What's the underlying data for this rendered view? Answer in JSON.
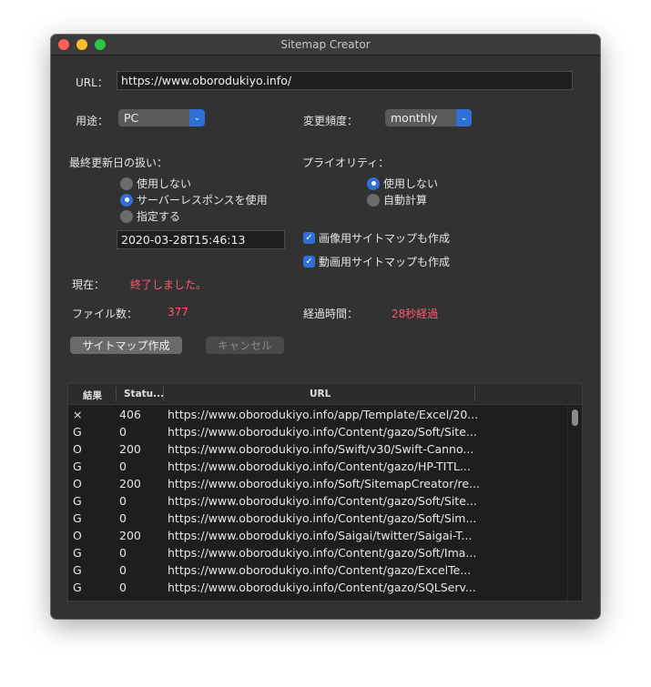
{
  "window": {
    "title": "Sitemap Creator"
  },
  "form": {
    "url_label": "URL：",
    "url_value": "https://www.oborodukiyo.info/",
    "usage_label": "用途：",
    "usage_value": "PC",
    "freq_label": "変更頻度：",
    "freq_value": "monthly",
    "lastmod_label": "最終更新日の扱い：",
    "lastmod_options": [
      "使用しない",
      "サーバーレスポンスを使用",
      "指定する"
    ],
    "lastmod_selected": 1,
    "date_value": "2020-03-28T15:46:13",
    "priority_label": "プライオリティ：",
    "priority_options": [
      "使用しない",
      "自動計算"
    ],
    "priority_selected": 0,
    "image_sitemap_label": "画像用サイトマップも作成",
    "image_sitemap_checked": true,
    "video_sitemap_label": "動画用サイトマップも作成",
    "video_sitemap_checked": true
  },
  "status": {
    "current_label": "現在：",
    "current_value": "終了しました。",
    "files_label": "ファイル数：",
    "files_value": "377",
    "elapsed_label": "経過時間：",
    "elapsed_value": "28秒経過"
  },
  "buttons": {
    "create": "サイトマップ作成",
    "cancel": "キャンセル"
  },
  "colors": {
    "accent": "#2f6fd6",
    "status_red": "#ff5a6a"
  },
  "table": {
    "headers": [
      "結果",
      "Statu...",
      "URL"
    ],
    "rows": [
      [
        "×",
        "406",
        "https://www.oborodukiyo.info/app/Template/Excel/20..."
      ],
      [
        "G",
        "0",
        "https://www.oborodukiyo.info/Content/gazo/Soft/Site..."
      ],
      [
        "O",
        "200",
        "https://www.oborodukiyo.info/Swift/v30/Swift-Canno..."
      ],
      [
        "G",
        "0",
        "https://www.oborodukiyo.info/Content/gazo/HP-TITL..."
      ],
      [
        "O",
        "200",
        "https://www.oborodukiyo.info/Soft/SitemapCreator/re..."
      ],
      [
        "G",
        "0",
        "https://www.oborodukiyo.info/Content/gazo/Soft/Site..."
      ],
      [
        "G",
        "0",
        "https://www.oborodukiyo.info/Content/gazo/Soft/Sim..."
      ],
      [
        "O",
        "200",
        "https://www.oborodukiyo.info/Saigai/twitter/Saigai-T..."
      ],
      [
        "G",
        "0",
        "https://www.oborodukiyo.info/Content/gazo/Soft/Ima..."
      ],
      [
        "G",
        "0",
        "https://www.oborodukiyo.info/Content/gazo/ExcelTe..."
      ],
      [
        "G",
        "0",
        "https://www.oborodukiyo.info/Content/gazo/SQLServ..."
      ]
    ]
  }
}
